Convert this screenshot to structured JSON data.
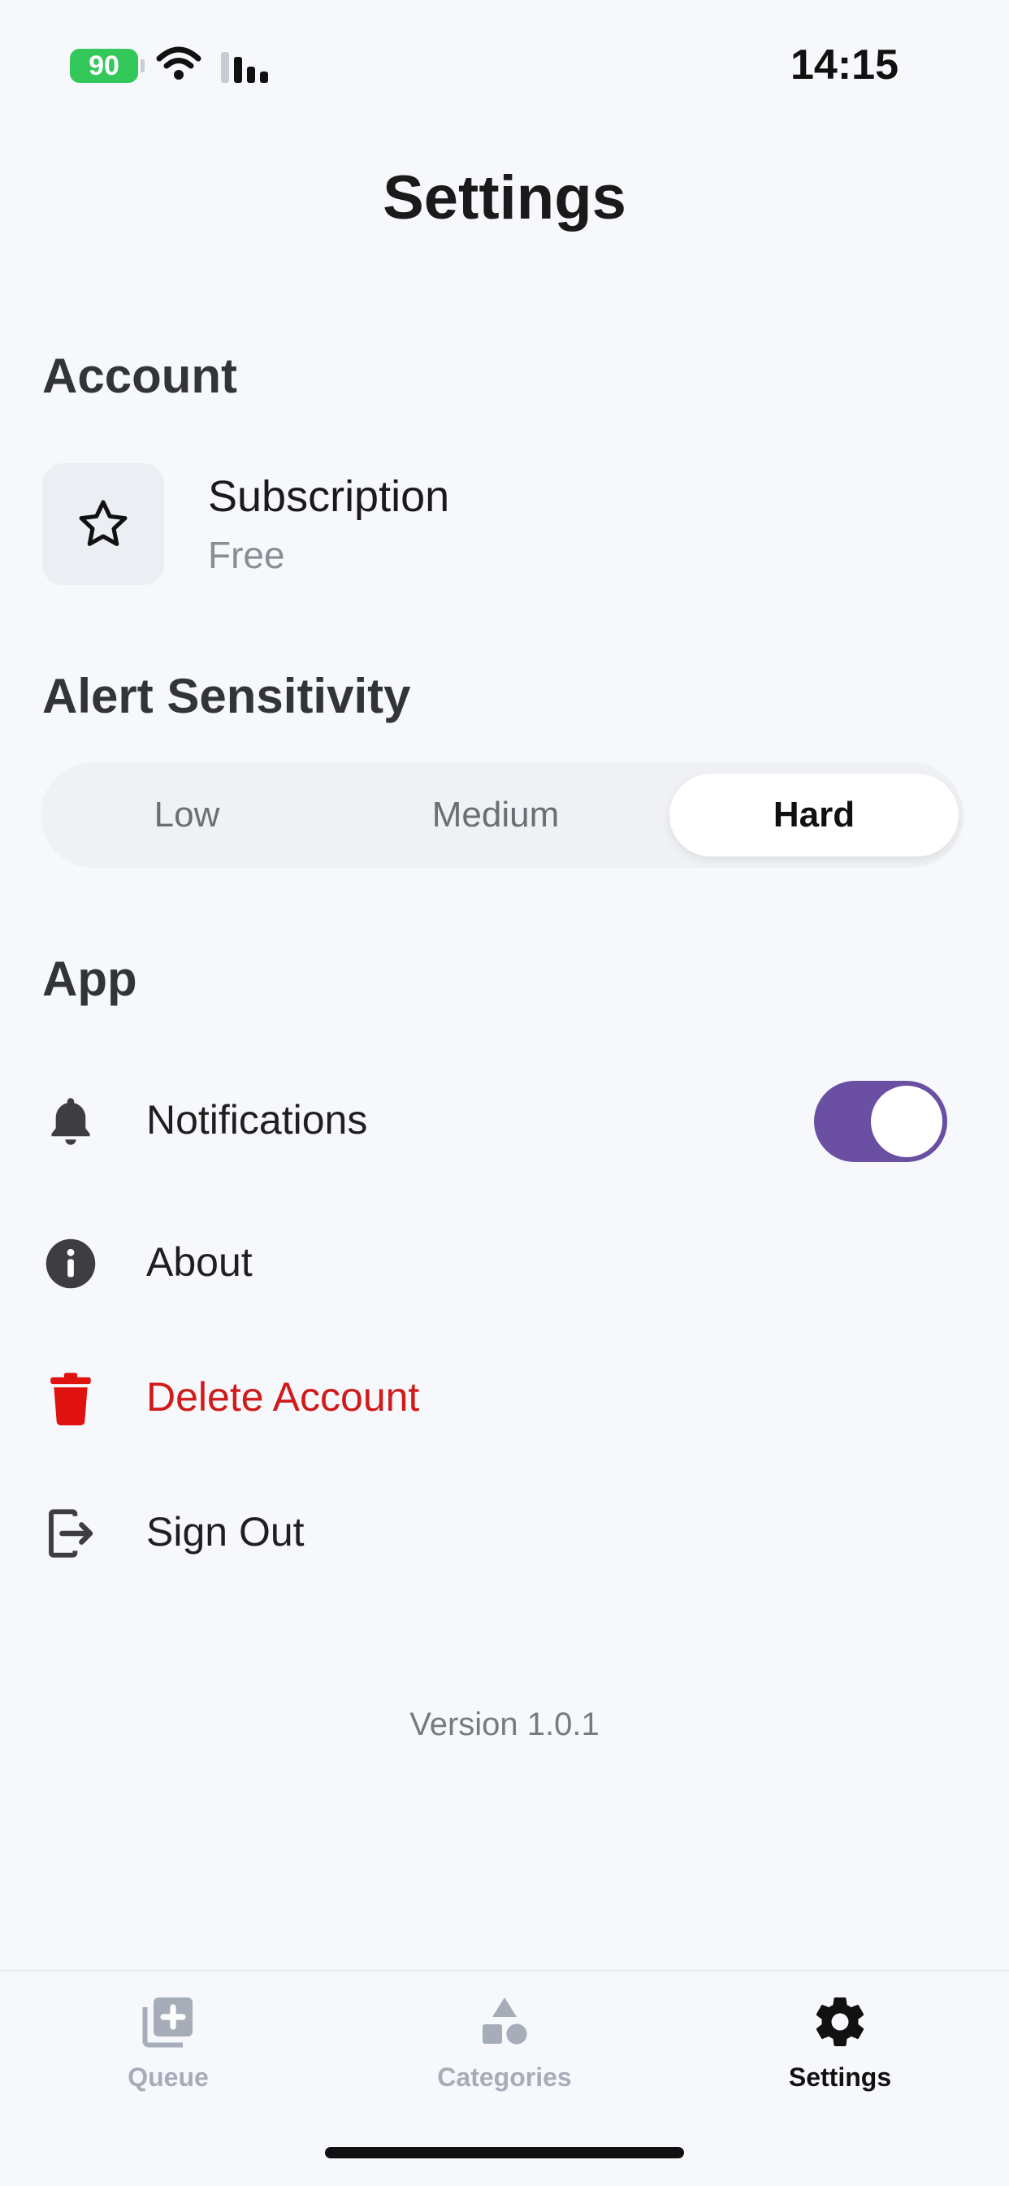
{
  "status_bar": {
    "battery": "90",
    "time": "14:15"
  },
  "header": {
    "title": "Settings"
  },
  "account": {
    "section_title": "Account",
    "subscription_label": "Subscription",
    "subscription_value": "Free",
    "icon": "star-icon"
  },
  "alert_sensitivity": {
    "section_title": "Alert Sensitivity",
    "options": [
      "Low",
      "Medium",
      "Hard"
    ],
    "selected": "Hard"
  },
  "app": {
    "section_title": "App",
    "items": [
      {
        "label": "Notifications",
        "icon": "bell-icon",
        "toggle_on": true
      },
      {
        "label": "About",
        "icon": "info-icon"
      },
      {
        "label": "Delete Account",
        "icon": "trash-icon",
        "color": "#d11a1a"
      },
      {
        "label": "Sign Out",
        "icon": "sign-out-icon"
      }
    ]
  },
  "version": "Version 1.0.1",
  "tabbar": {
    "tabs": [
      {
        "label": "Queue",
        "icon": "queue-add-icon",
        "active": false
      },
      {
        "label": "Categories",
        "icon": "shapes-icon",
        "active": false
      },
      {
        "label": "Settings",
        "icon": "gear-icon",
        "active": true
      }
    ]
  },
  "colors": {
    "accent": "#6a4fa3",
    "danger": "#d11a1a",
    "battery": "#34c759"
  }
}
